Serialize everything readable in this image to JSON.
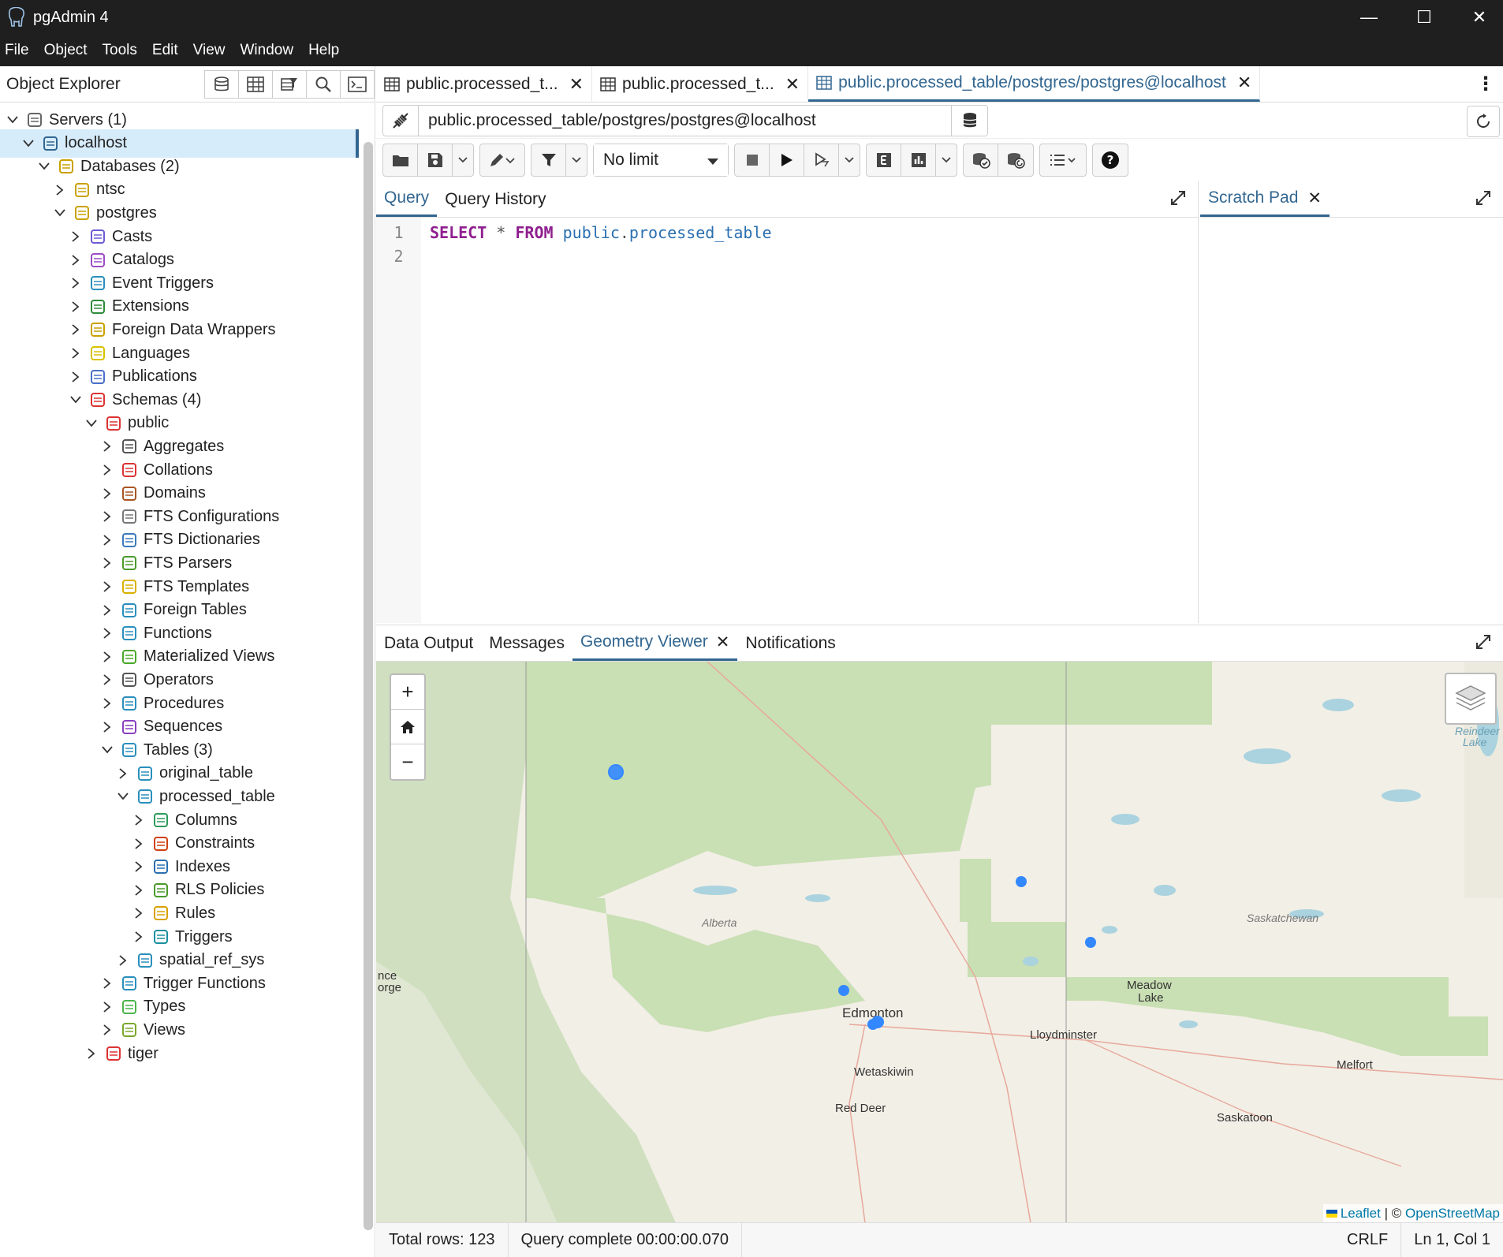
{
  "window": {
    "title": "pgAdmin 4"
  },
  "menu": [
    "File",
    "Object",
    "Tools",
    "Edit",
    "View",
    "Window",
    "Help"
  ],
  "object_explorer": {
    "title": "Object Explorer",
    "tree": [
      {
        "label": "Servers (1)",
        "level": 0,
        "expanded": true,
        "icon": "servers-icon"
      },
      {
        "label": "localhost",
        "level": 1,
        "expanded": true,
        "icon": "server-icon",
        "selected": true
      },
      {
        "label": "Databases (2)",
        "level": 2,
        "expanded": true,
        "icon": "databases-icon"
      },
      {
        "label": "ntsc",
        "level": 3,
        "expanded": false,
        "icon": "database-icon"
      },
      {
        "label": "postgres",
        "level": 3,
        "expanded": true,
        "icon": "database-icon"
      },
      {
        "label": "Casts",
        "level": 4,
        "expanded": false,
        "icon": "casts-icon"
      },
      {
        "label": "Catalogs",
        "level": 4,
        "expanded": false,
        "icon": "catalogs-icon"
      },
      {
        "label": "Event Triggers",
        "level": 4,
        "expanded": false,
        "icon": "event-triggers-icon"
      },
      {
        "label": "Extensions",
        "level": 4,
        "expanded": false,
        "icon": "extensions-icon"
      },
      {
        "label": "Foreign Data Wrappers",
        "level": 4,
        "expanded": false,
        "icon": "fdw-icon"
      },
      {
        "label": "Languages",
        "level": 4,
        "expanded": false,
        "icon": "languages-icon"
      },
      {
        "label": "Publications",
        "level": 4,
        "expanded": false,
        "icon": "publications-icon"
      },
      {
        "label": "Schemas (4)",
        "level": 4,
        "expanded": true,
        "icon": "schemas-icon"
      },
      {
        "label": "public",
        "level": 5,
        "expanded": true,
        "icon": "schema-icon"
      },
      {
        "label": "Aggregates",
        "level": 6,
        "expanded": false,
        "icon": "aggregates-icon"
      },
      {
        "label": "Collations",
        "level": 6,
        "expanded": false,
        "icon": "collations-icon"
      },
      {
        "label": "Domains",
        "level": 6,
        "expanded": false,
        "icon": "domains-icon"
      },
      {
        "label": "FTS Configurations",
        "level": 6,
        "expanded": false,
        "icon": "fts-config-icon"
      },
      {
        "label": "FTS Dictionaries",
        "level": 6,
        "expanded": false,
        "icon": "fts-dict-icon"
      },
      {
        "label": "FTS Parsers",
        "level": 6,
        "expanded": false,
        "icon": "fts-parser-icon"
      },
      {
        "label": "FTS Templates",
        "level": 6,
        "expanded": false,
        "icon": "fts-template-icon"
      },
      {
        "label": "Foreign Tables",
        "level": 6,
        "expanded": false,
        "icon": "foreign-tables-icon"
      },
      {
        "label": "Functions",
        "level": 6,
        "expanded": false,
        "icon": "functions-icon"
      },
      {
        "label": "Materialized Views",
        "level": 6,
        "expanded": false,
        "icon": "mviews-icon"
      },
      {
        "label": "Operators",
        "level": 6,
        "expanded": false,
        "icon": "operators-icon"
      },
      {
        "label": "Procedures",
        "level": 6,
        "expanded": false,
        "icon": "procedures-icon"
      },
      {
        "label": "Sequences",
        "level": 6,
        "expanded": false,
        "icon": "sequences-icon"
      },
      {
        "label": "Tables (3)",
        "level": 6,
        "expanded": true,
        "icon": "tables-icon"
      },
      {
        "label": "original_table",
        "level": 7,
        "expanded": false,
        "icon": "table-icon"
      },
      {
        "label": "processed_table",
        "level": 7,
        "expanded": true,
        "icon": "table-icon"
      },
      {
        "label": "Columns",
        "level": 8,
        "expanded": false,
        "icon": "columns-icon"
      },
      {
        "label": "Constraints",
        "level": 8,
        "expanded": false,
        "icon": "constraints-icon"
      },
      {
        "label": "Indexes",
        "level": 8,
        "expanded": false,
        "icon": "indexes-icon"
      },
      {
        "label": "RLS Policies",
        "level": 8,
        "expanded": false,
        "icon": "rls-icon"
      },
      {
        "label": "Rules",
        "level": 8,
        "expanded": false,
        "icon": "rules-icon"
      },
      {
        "label": "Triggers",
        "level": 8,
        "expanded": false,
        "icon": "triggers-icon"
      },
      {
        "label": "spatial_ref_sys",
        "level": 7,
        "expanded": false,
        "icon": "table-icon"
      },
      {
        "label": "Trigger Functions",
        "level": 6,
        "expanded": false,
        "icon": "trigger-functions-icon"
      },
      {
        "label": "Types",
        "level": 6,
        "expanded": false,
        "icon": "types-icon"
      },
      {
        "label": "Views",
        "level": 6,
        "expanded": false,
        "icon": "views-icon"
      },
      {
        "label": "tiger",
        "level": 5,
        "expanded": false,
        "icon": "schema-icon"
      }
    ]
  },
  "tabs": [
    {
      "label": "public.processed_t...",
      "active": false
    },
    {
      "label": "public.processed_t...",
      "active": false
    },
    {
      "label": "public.processed_table/postgres/postgres@localhost",
      "active": true
    }
  ],
  "connection": {
    "text": "public.processed_table/postgres/postgres@localhost"
  },
  "toolbar": {
    "limit": "No limit"
  },
  "query_tabs": {
    "query": "Query",
    "history": "Query History"
  },
  "scratch": {
    "label": "Scratch Pad"
  },
  "editor": {
    "line_numbers": [
      "1",
      "2"
    ],
    "sql": {
      "select": "SELECT",
      "star": "*",
      "from": "FROM",
      "schema": "public",
      "dot": ".",
      "table": "processed_table"
    }
  },
  "result_tabs": {
    "data_output": "Data Output",
    "messages": "Messages",
    "geometry": "Geometry Viewer",
    "notifications": "Notifications"
  },
  "map": {
    "labels": {
      "alberta": "Alberta",
      "saskatchewan": "Saskatchewan",
      "edmonton": "Edmonton",
      "meadow_lake_1": "Meadow",
      "meadow_lake_2": "Lake",
      "lloydminster": "Lloydminster",
      "wetaskiwin": "Wetaskiwin",
      "red_deer": "Red Deer",
      "melfort": "Melfort",
      "saskatoon": "Saskatoon",
      "reindeer_1": "Reindeer",
      "reindeer_2": "Lake",
      "nce": "nce",
      "orge": "orge"
    },
    "zoom_in": "+",
    "zoom_out": "−",
    "attribution": {
      "leaflet": "Leaflet",
      "sep": " | © ",
      "osm": "OpenStreetMap"
    },
    "point_color": "#3388ff"
  },
  "status": {
    "rows": "Total rows: 123",
    "query": "Query complete 00:00:00.070",
    "eol": "CRLF",
    "pos": "Ln 1, Col 1"
  }
}
